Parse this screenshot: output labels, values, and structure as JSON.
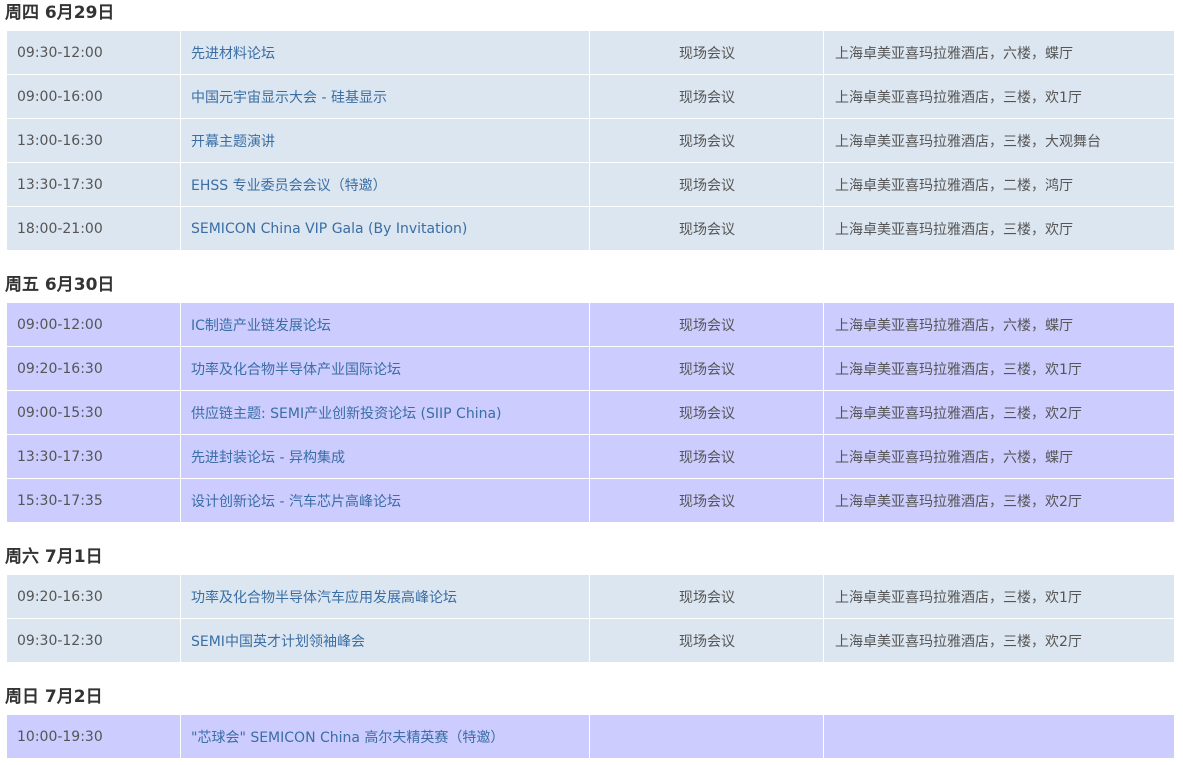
{
  "days": [
    {
      "heading": "周四 6月29日",
      "theme": "blue",
      "rows": [
        {
          "time": "09:30-12:00",
          "title": "先进材料论坛",
          "type": "现场会议",
          "venue": "上海卓美亚喜玛拉雅酒店，六楼，蝶厅"
        },
        {
          "time": "09:00-16:00",
          "title": "中国元宇宙显示大会 - 硅基显示",
          "type": "现场会议",
          "venue": "上海卓美亚喜玛拉雅酒店，三楼，欢1厅"
        },
        {
          "time": "13:00-16:30",
          "title": "开幕主题演讲",
          "type": "现场会议",
          "venue": "上海卓美亚喜玛拉雅酒店，三楼，大观舞台"
        },
        {
          "time": "13:30-17:30",
          "title": "EHSS 专业委员会会议（特邀）",
          "type": "现场会议",
          "venue": "上海卓美亚喜玛拉雅酒店，二楼，鸿厅"
        },
        {
          "time": "18:00-21:00",
          "title": "SEMICON China VIP Gala (By Invitation)",
          "type": "现场会议",
          "venue": "上海卓美亚喜玛拉雅酒店，三楼，欢厅"
        }
      ]
    },
    {
      "heading": "周五 6月30日",
      "theme": "purple",
      "rows": [
        {
          "time": "09:00-12:00",
          "title": "IC制造产业链发展论坛",
          "type": "现场会议",
          "venue": "上海卓美亚喜玛拉雅酒店，六楼，蝶厅"
        },
        {
          "time": "09:20-16:30",
          "title": "功率及化合物半导体产业国际论坛",
          "type": "现场会议",
          "venue": "上海卓美亚喜玛拉雅酒店，三楼，欢1厅"
        },
        {
          "time": "09:00-15:30",
          "title": "供应链主题: SEMI产业创新投资论坛 (SIIP China)",
          "type": "现场会议",
          "venue": "上海卓美亚喜玛拉雅酒店，三楼，欢2厅"
        },
        {
          "time": "13:30-17:30",
          "title": "先进封装论坛 - 异构集成",
          "type": "现场会议",
          "venue": "上海卓美亚喜玛拉雅酒店，六楼，蝶厅"
        },
        {
          "time": "15:30-17:35",
          "title": "设计创新论坛 - 汽车芯片高峰论坛",
          "type": "现场会议",
          "venue": "上海卓美亚喜玛拉雅酒店，三楼，欢2厅"
        }
      ]
    },
    {
      "heading": "周六 7月1日",
      "theme": "blue",
      "rows": [
        {
          "time": "09:20-16:30",
          "title": "功率及化合物半导体汽车应用发展高峰论坛",
          "type": "现场会议",
          "venue": "上海卓美亚喜玛拉雅酒店，三楼，欢1厅"
        },
        {
          "time": "09:30-12:30",
          "title": "SEMI中国英才计划领袖峰会",
          "type": "现场会议",
          "venue": "上海卓美亚喜玛拉雅酒店，三楼，欢2厅"
        }
      ]
    },
    {
      "heading": "周日 7月2日",
      "theme": "purple",
      "rows": [
        {
          "time": "10:00-19:30",
          "title": "\"芯球会\" SEMICON China 高尔夫精英赛（特邀）",
          "type": "",
          "venue": ""
        }
      ]
    }
  ],
  "colors": {
    "blue_row": "#dce6f0",
    "purple_row": "#ccccff",
    "link": "#3a6ea5",
    "text": "#555555",
    "heading": "#333333"
  }
}
